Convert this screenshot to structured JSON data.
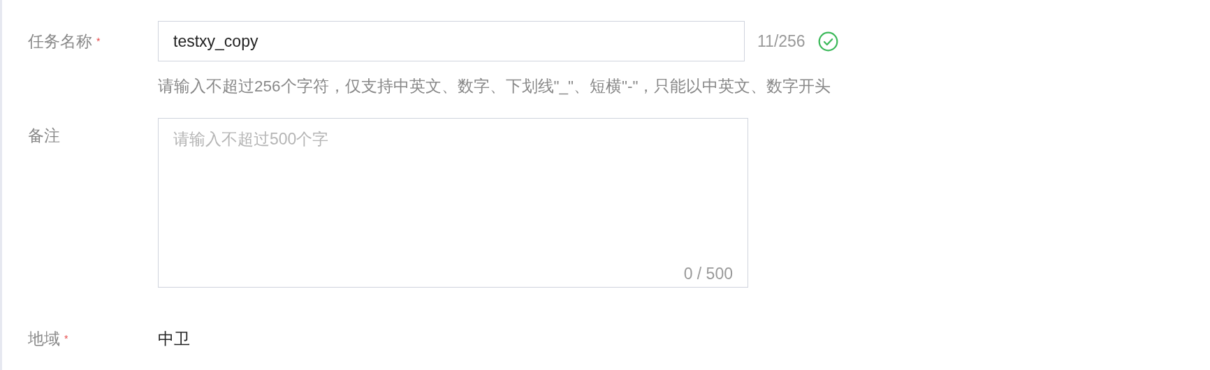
{
  "fields": [
    {
      "kind": "text",
      "label": "任务名称",
      "mark": "*",
      "value": "testxy_copy",
      "counter": "11/256",
      "valid": true,
      "hint": "请输入不超过256个字符，仅支持中英文、数字、下划线\"_\"、短横\"-\"，只能以中英文、数字开头"
    },
    {
      "kind": "textarea",
      "label": "备注",
      "placeholder": "请输入不超过500个字",
      "counter": "0 / 500"
    },
    {
      "kind": "static",
      "label": "地域",
      "mark": "*",
      "value": "中卫"
    }
  ]
}
